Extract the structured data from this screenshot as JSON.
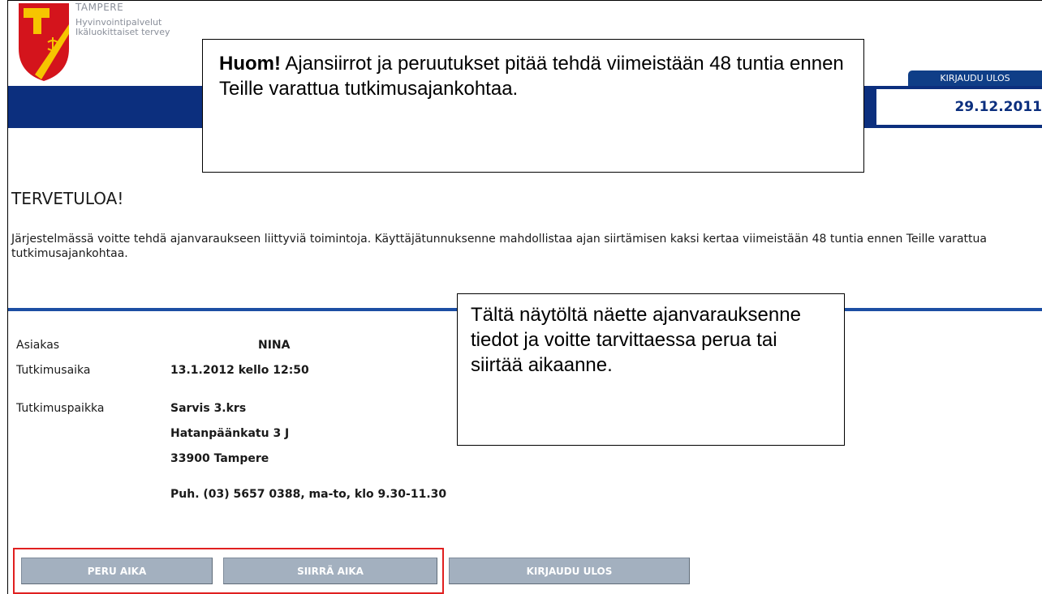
{
  "header": {
    "org_name": "TAMPERE",
    "org_line1": "Hyvinvointipalvelut",
    "org_line2": "Ikäluokittaiset tervey",
    "logout_tab": "KIRJAUDU ULOS",
    "date": "29.12.2011"
  },
  "callouts": {
    "top_bold": "Huom!",
    "top_text": " Ajansiirrot ja peruutukset pitää tehdä viimeistään 48 tuntia ennen Teille varattua tutkimusajankohtaa.",
    "middle_text": "Tältä näytöltä näette ajanvarauksenne tiedot ja voitte tarvittaessa perua tai siirtää aikaanne."
  },
  "main": {
    "welcome": "TERVETULOA!",
    "intro": "Järjestelmässä voitte tehdä ajanvaraukseen liittyviä toimintoja. Käyttäjätunnuksenne mahdollistaa ajan siirtämisen kaksi kertaa viimeistään 48 tuntia ennen Teille varattua tutkimusajankohtaa."
  },
  "appointment": {
    "customer_label": "Asiakas",
    "customer_value": "NINA",
    "time_label": "Tutkimusaika",
    "time_value": "13.1.2012 kello 12:50",
    "place_label": "Tutkimuspaikka",
    "place_line1": "Sarvis 3.krs",
    "place_line2": "Hatanpäänkatu 3 J",
    "place_line3": "33900 Tampere",
    "phone": "Puh. (03) 5657 0388, ma-to, klo 9.30-11.30"
  },
  "buttons": {
    "cancel": "PERU AIKA",
    "move": "SIIRRÄ AIKA",
    "logout": "KIRJAUDU ULOS"
  },
  "colors": {
    "header_bar": "#0c2f7e",
    "rule": "#1c4ea3",
    "button": "#a3b0bf",
    "highlight": "#e02020",
    "logo_red": "#d4141c",
    "logo_yellow": "#f6c500"
  }
}
